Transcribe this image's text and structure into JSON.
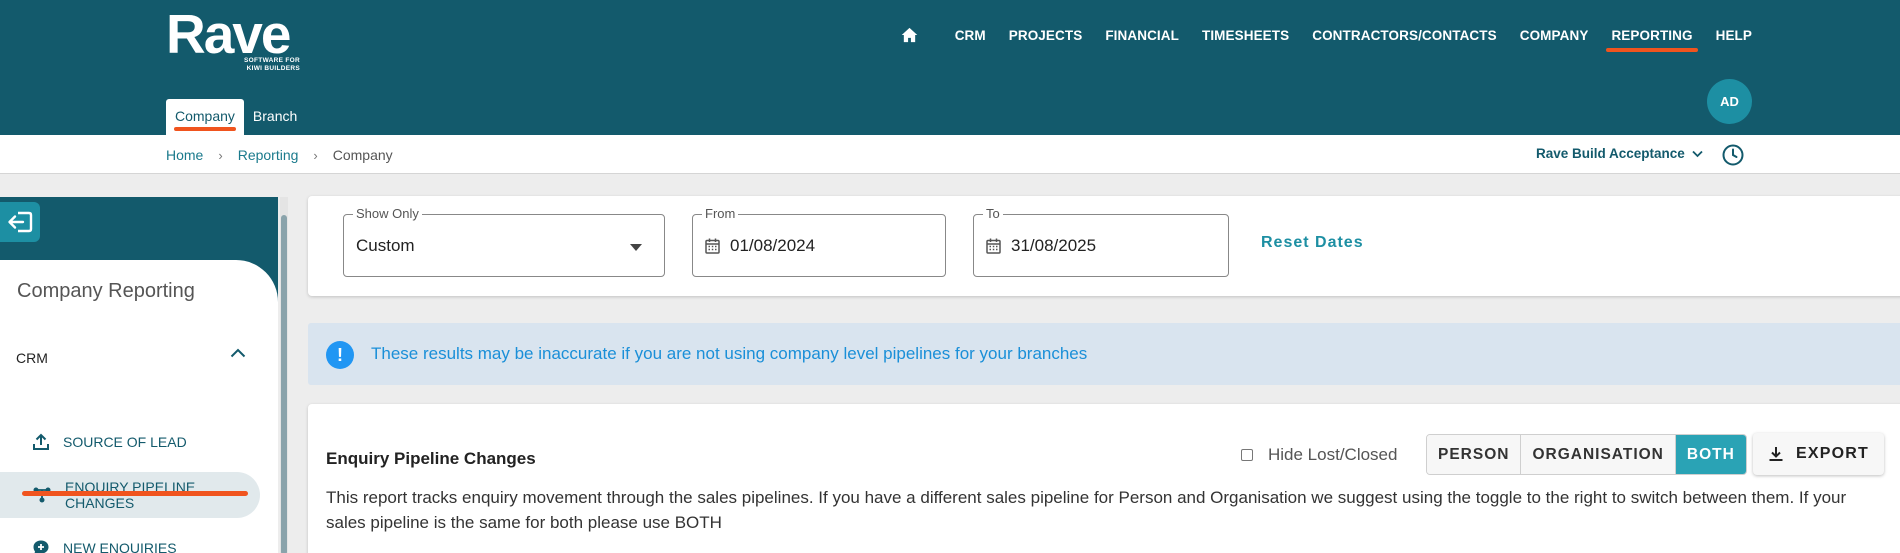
{
  "brand": {
    "name": "Rave",
    "tagline_line1": "SOFTWARE FOR",
    "tagline_line2": "KIWI BUILDERS"
  },
  "topnav": {
    "home_icon": "home-icon",
    "items": [
      "CRM",
      "PROJECTS",
      "FINANCIAL",
      "TIMESHEETS",
      "CONTRACTORS/CONTACTS",
      "COMPANY",
      "REPORTING",
      "HELP"
    ],
    "active": "REPORTING"
  },
  "subtabs": {
    "company": "Company",
    "branch": "Branch",
    "active": "Company"
  },
  "user": {
    "initials": "AD"
  },
  "breadcrumb": {
    "home": "Home",
    "reporting": "Reporting",
    "current": "Company"
  },
  "environment": {
    "selected": "Rave Build Acceptance"
  },
  "sidebar": {
    "title": "Company Reporting",
    "section": "CRM",
    "items": [
      {
        "label": "SOURCE OF LEAD",
        "icon": "upload-icon"
      },
      {
        "label": "ENQUIRY PIPELINE CHANGES",
        "icon": "pipeline-icon",
        "active": true
      },
      {
        "label": "NEW ENQUIRIES",
        "icon": "chat-plus-icon"
      }
    ]
  },
  "filters": {
    "show_only": {
      "label": "Show Only",
      "value": "Custom"
    },
    "from": {
      "label": "From",
      "value": "01/08/2024"
    },
    "to": {
      "label": "To",
      "value": "31/08/2025"
    },
    "reset_label": "Reset Dates"
  },
  "banner": {
    "text": "These results may be inaccurate if you are not using company level pipelines for your branches"
  },
  "report": {
    "title": "Enquiry Pipeline Changes",
    "hide_lost_label": "Hide Lost/Closed",
    "toggle": {
      "person": "PERSON",
      "organisation": "ORGANISATION",
      "both": "BOTH",
      "active": "BOTH"
    },
    "export_label": "EXPORT",
    "description": "This report tracks enquiry movement through the sales pipelines. If you have a different sales pipeline for Person and Organisation we suggest using the toggle to the right to switch between them. If your sales pipeline is the same for both please use BOTH"
  },
  "colors": {
    "header": "#135a6c",
    "accent": "#1d8fa3",
    "highlight": "#f0541e",
    "info": "#2196f3",
    "banner_bg": "#d9e4ef"
  }
}
